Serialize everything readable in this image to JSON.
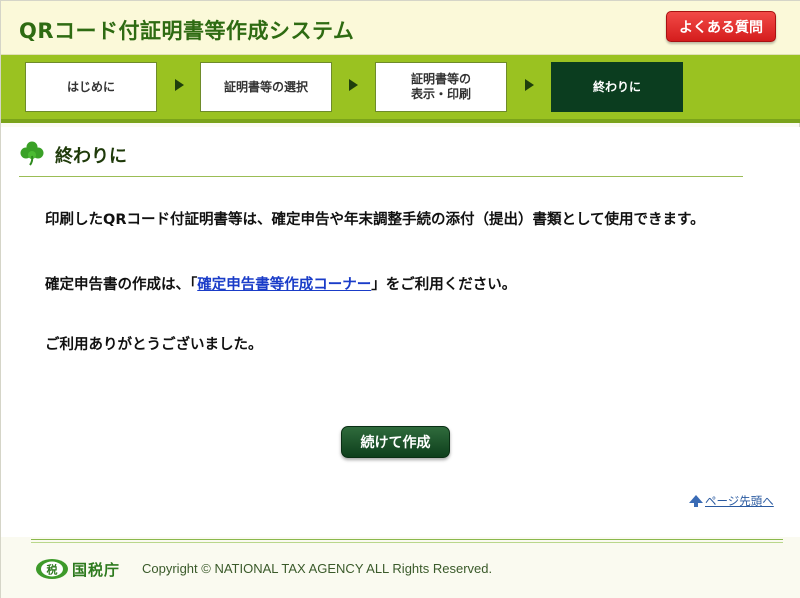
{
  "header": {
    "app_title": "QRコード付証明書等作成システム",
    "faq_label": "よくある質問"
  },
  "steps": [
    {
      "label": "はじめに",
      "state": "done"
    },
    {
      "label": "証明書等の選択",
      "state": "done"
    },
    {
      "label": "証明書等の\n表示・印刷",
      "state": "done"
    },
    {
      "label": "終わりに",
      "state": "active"
    }
  ],
  "section": {
    "title": "終わりに",
    "icon": "clover-icon"
  },
  "content": {
    "para1": "印刷したQRコード付証明書等は、確定申告や年末調整手続の添付（提出）書類として使用できます。",
    "para2_before": "確定申告書の作成は、「",
    "para2_link": "確定申告書等作成コーナー",
    "para2_after": "」をご利用ください。",
    "para3": "ご利用ありがとうございました。"
  },
  "actions": {
    "continue_label": "続けて作成",
    "page_top_label": "ページ先頭へ"
  },
  "footer": {
    "agency_name": "国税庁",
    "seal_text": "税",
    "copyright": "Copyright © NATIONAL TAX AGENCY ALL Rights Reserved."
  },
  "colors": {
    "brand_green": "#2e6b12",
    "step_bar": "#9ac221",
    "active_step": "#0b3d1f",
    "faq_red": "#d41d1d",
    "link_blue": "#1a3cc8"
  }
}
